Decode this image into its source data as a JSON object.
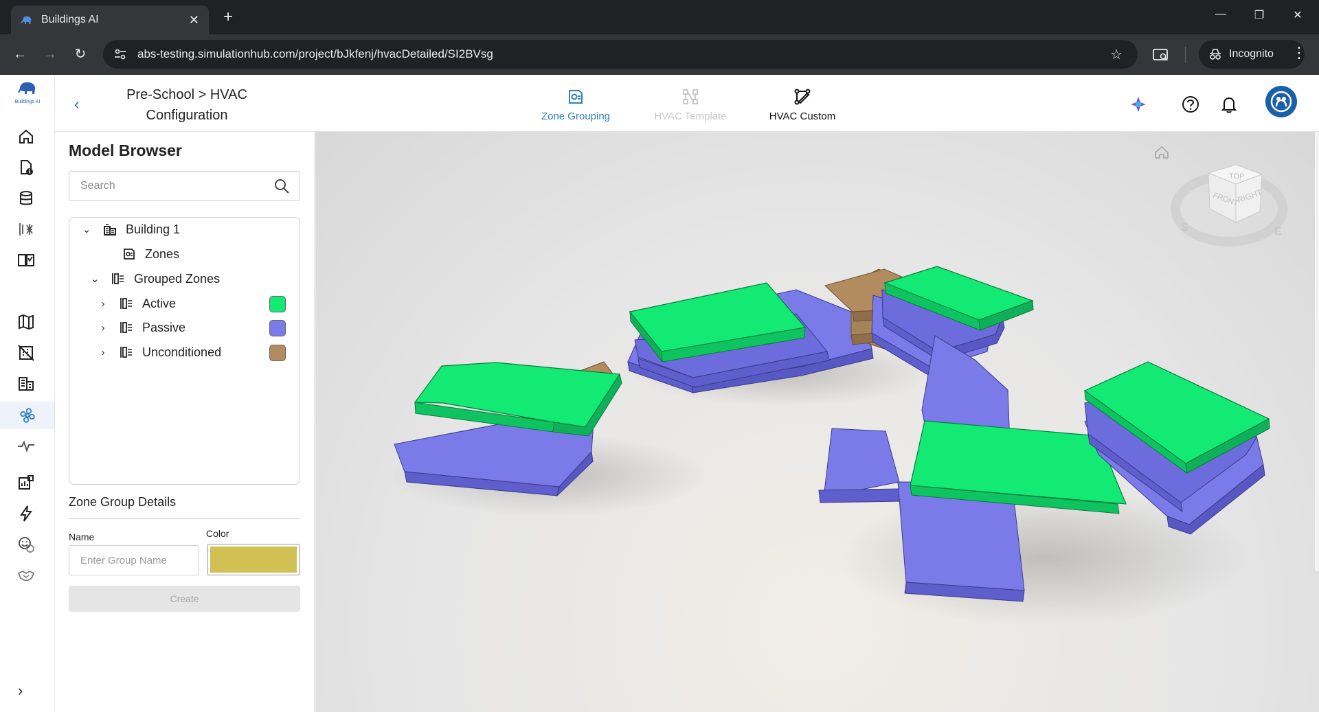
{
  "browser": {
    "tab_title": "Buildings AI",
    "tab_close": "✕",
    "new_tab": "+",
    "url": "abs-testing.simulationhub.com/project/bJkfenj/hvacDetailed/SI2BVsg",
    "incognito_label": "Incognito",
    "window_controls": [
      "—",
      "❐",
      "✕"
    ]
  },
  "app": {
    "logo_text": "Buildings AI",
    "breadcrumb": "Pre-School > HVAC Configuration",
    "tabs": [
      {
        "label": "Zone Grouping",
        "state": "selected"
      },
      {
        "label": "HVAC Template",
        "state": "disabled"
      },
      {
        "label": "HVAC Custom",
        "state": "normal"
      }
    ],
    "accent_color": "#2c7fc2"
  },
  "model_browser": {
    "title": "Model Browser",
    "search_placeholder": "Search",
    "tree": {
      "building": "Building 1",
      "zones": "Zones",
      "grouped_zones": "Grouped Zones",
      "groups": [
        {
          "label": "Active",
          "color": "#12ea74"
        },
        {
          "label": "Passive",
          "color": "#7a7ae8"
        },
        {
          "label": "Unconditioned",
          "color": "#b28b5f"
        }
      ]
    }
  },
  "zone_group_details": {
    "title": "Zone Group Details",
    "name_label": "Name",
    "name_placeholder": "Enter Group Name",
    "color_label": "Color",
    "color_value": "#d1c155",
    "create_label": "Create"
  },
  "viewcube": {
    "faces": [
      "TOP",
      "FRONT",
      "RIGHT"
    ],
    "compass": [
      "S",
      "E"
    ]
  }
}
